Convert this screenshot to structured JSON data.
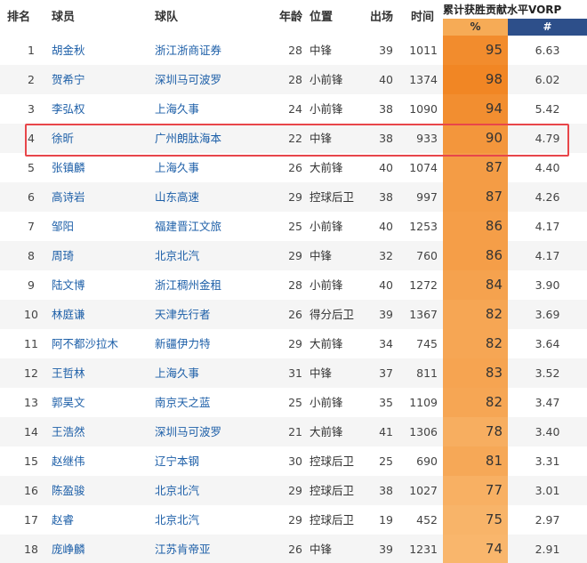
{
  "headers": {
    "rank": "排名",
    "player": "球员",
    "team": "球队",
    "age": "年龄",
    "position": "位置",
    "games": "出场",
    "time": "时间",
    "vorp_title": "累计获胜贡献水平VORP",
    "vorp_pct": "%",
    "vorp_num": "#"
  },
  "colors": {
    "link": "#1d5fa8",
    "highlight": "#e8464a",
    "pct_header": "#f6ab56",
    "num_header": "#2d4f8a"
  },
  "highlighted_rank": "4",
  "rows": [
    {
      "rank": "1",
      "player": "胡金秋",
      "team": "浙江浙商证券",
      "age": "28",
      "position": "中锋",
      "games": "39",
      "time": "1011",
      "pct": "95",
      "vorp": "6.63"
    },
    {
      "rank": "2",
      "player": "贺希宁",
      "team": "深圳马可波罗",
      "age": "28",
      "position": "小前锋",
      "games": "40",
      "time": "1374",
      "pct": "98",
      "vorp": "6.02"
    },
    {
      "rank": "3",
      "player": "李弘权",
      "team": "上海久事",
      "age": "24",
      "position": "小前锋",
      "games": "38",
      "time": "1090",
      "pct": "94",
      "vorp": "5.42"
    },
    {
      "rank": "4",
      "player": "徐昕",
      "team": "广州朗肽海本",
      "age": "22",
      "position": "中锋",
      "games": "38",
      "time": "933",
      "pct": "90",
      "vorp": "4.79"
    },
    {
      "rank": "5",
      "player": "张镇麟",
      "team": "上海久事",
      "age": "26",
      "position": "大前锋",
      "games": "40",
      "time": "1074",
      "pct": "87",
      "vorp": "4.40"
    },
    {
      "rank": "6",
      "player": "高诗岩",
      "team": "山东高速",
      "age": "29",
      "position": "控球后卫",
      "games": "38",
      "time": "997",
      "pct": "87",
      "vorp": "4.26"
    },
    {
      "rank": "7",
      "player": "邹阳",
      "team": "福建晋江文旅",
      "age": "25",
      "position": "小前锋",
      "games": "40",
      "time": "1253",
      "pct": "86",
      "vorp": "4.17"
    },
    {
      "rank": "8",
      "player": "周琦",
      "team": "北京北汽",
      "age": "29",
      "position": "中锋",
      "games": "32",
      "time": "760",
      "pct": "86",
      "vorp": "4.17"
    },
    {
      "rank": "9",
      "player": "陆文博",
      "team": "浙江稠州金租",
      "age": "28",
      "position": "小前锋",
      "games": "40",
      "time": "1272",
      "pct": "84",
      "vorp": "3.90"
    },
    {
      "rank": "10",
      "player": "林庭谦",
      "team": "天津先行者",
      "age": "26",
      "position": "得分后卫",
      "games": "39",
      "time": "1367",
      "pct": "82",
      "vorp": "3.69"
    },
    {
      "rank": "11",
      "player": "阿不都沙拉木",
      "team": "新疆伊力特",
      "age": "29",
      "position": "大前锋",
      "games": "34",
      "time": "745",
      "pct": "82",
      "vorp": "3.64"
    },
    {
      "rank": "12",
      "player": "王哲林",
      "team": "上海久事",
      "age": "31",
      "position": "中锋",
      "games": "37",
      "time": "811",
      "pct": "83",
      "vorp": "3.52"
    },
    {
      "rank": "13",
      "player": "郭昊文",
      "team": "南京天之蓝",
      "age": "25",
      "position": "小前锋",
      "games": "35",
      "time": "1109",
      "pct": "82",
      "vorp": "3.47"
    },
    {
      "rank": "14",
      "player": "王浩然",
      "team": "深圳马可波罗",
      "age": "21",
      "position": "大前锋",
      "games": "41",
      "time": "1306",
      "pct": "78",
      "vorp": "3.40"
    },
    {
      "rank": "15",
      "player": "赵继伟",
      "team": "辽宁本钢",
      "age": "30",
      "position": "控球后卫",
      "games": "25",
      "time": "690",
      "pct": "81",
      "vorp": "3.31"
    },
    {
      "rank": "16",
      "player": "陈盈骏",
      "team": "北京北汽",
      "age": "29",
      "position": "控球后卫",
      "games": "38",
      "time": "1027",
      "pct": "77",
      "vorp": "3.01"
    },
    {
      "rank": "17",
      "player": "赵睿",
      "team": "北京北汽",
      "age": "29",
      "position": "控球后卫",
      "games": "19",
      "time": "452",
      "pct": "75",
      "vorp": "2.97"
    },
    {
      "rank": "18",
      "player": "庞峥麟",
      "team": "江苏肯帝亚",
      "age": "26",
      "position": "中锋",
      "games": "39",
      "time": "1231",
      "pct": "74",
      "vorp": "2.91"
    }
  ]
}
